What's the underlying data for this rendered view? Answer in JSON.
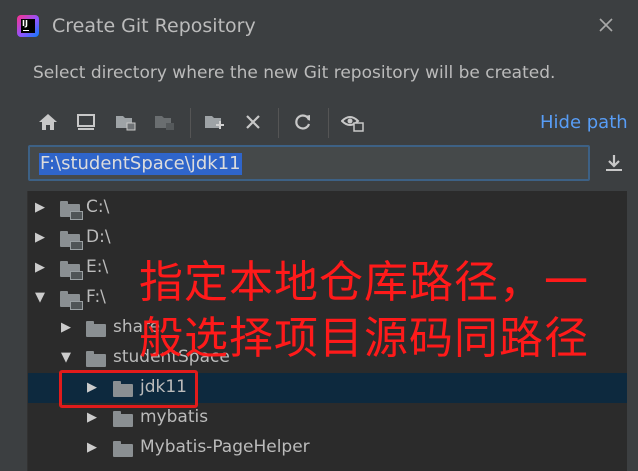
{
  "window": {
    "title": "Create Git Repository",
    "description": "Select directory where the new Git repository will be created.",
    "logo_icon": "intellij-idea-icon",
    "logo_text": "IJ"
  },
  "toolbar": {
    "buttons": [
      "home-icon",
      "desktop-icon",
      "project-folder-icon",
      "module-folder-icon",
      "new-folder-icon",
      "delete-icon",
      "refresh-icon",
      "show-hidden-icon"
    ],
    "hide_path_label": "Hide path"
  },
  "path": {
    "value": "F:\\studentSpace\\jdk11"
  },
  "tree": {
    "items": [
      {
        "label": "C:\\",
        "arrow": "▶",
        "level": 0,
        "type": "drive"
      },
      {
        "label": "D:\\",
        "arrow": "▶",
        "level": 0,
        "type": "drive"
      },
      {
        "label": "E:\\",
        "arrow": "▶",
        "level": 0,
        "type": "drive"
      },
      {
        "label": "F:\\",
        "arrow": "▼",
        "level": 0,
        "type": "drive"
      },
      {
        "label": "share",
        "arrow": "▶",
        "level": 1,
        "type": "folder"
      },
      {
        "label": "studentSpace",
        "arrow": "▼",
        "level": 1,
        "type": "folder"
      },
      {
        "label": "jdk11",
        "arrow": "▶",
        "level": 2,
        "type": "folder",
        "selected": true
      },
      {
        "label": "mybatis",
        "arrow": "▶",
        "level": 2,
        "type": "folder"
      },
      {
        "label": "Mybatis-PageHelper",
        "arrow": "▶",
        "level": 2,
        "type": "folder"
      }
    ]
  },
  "annotation": {
    "line1": "指定本地仓库路径，一",
    "line2": "般选择项目源码同路径",
    "color": "#ff1a1a"
  },
  "colors": {
    "background": "#3c3f41",
    "tree_background": "#2b2b2b",
    "selection": "#0d293e",
    "link": "#589df6"
  }
}
